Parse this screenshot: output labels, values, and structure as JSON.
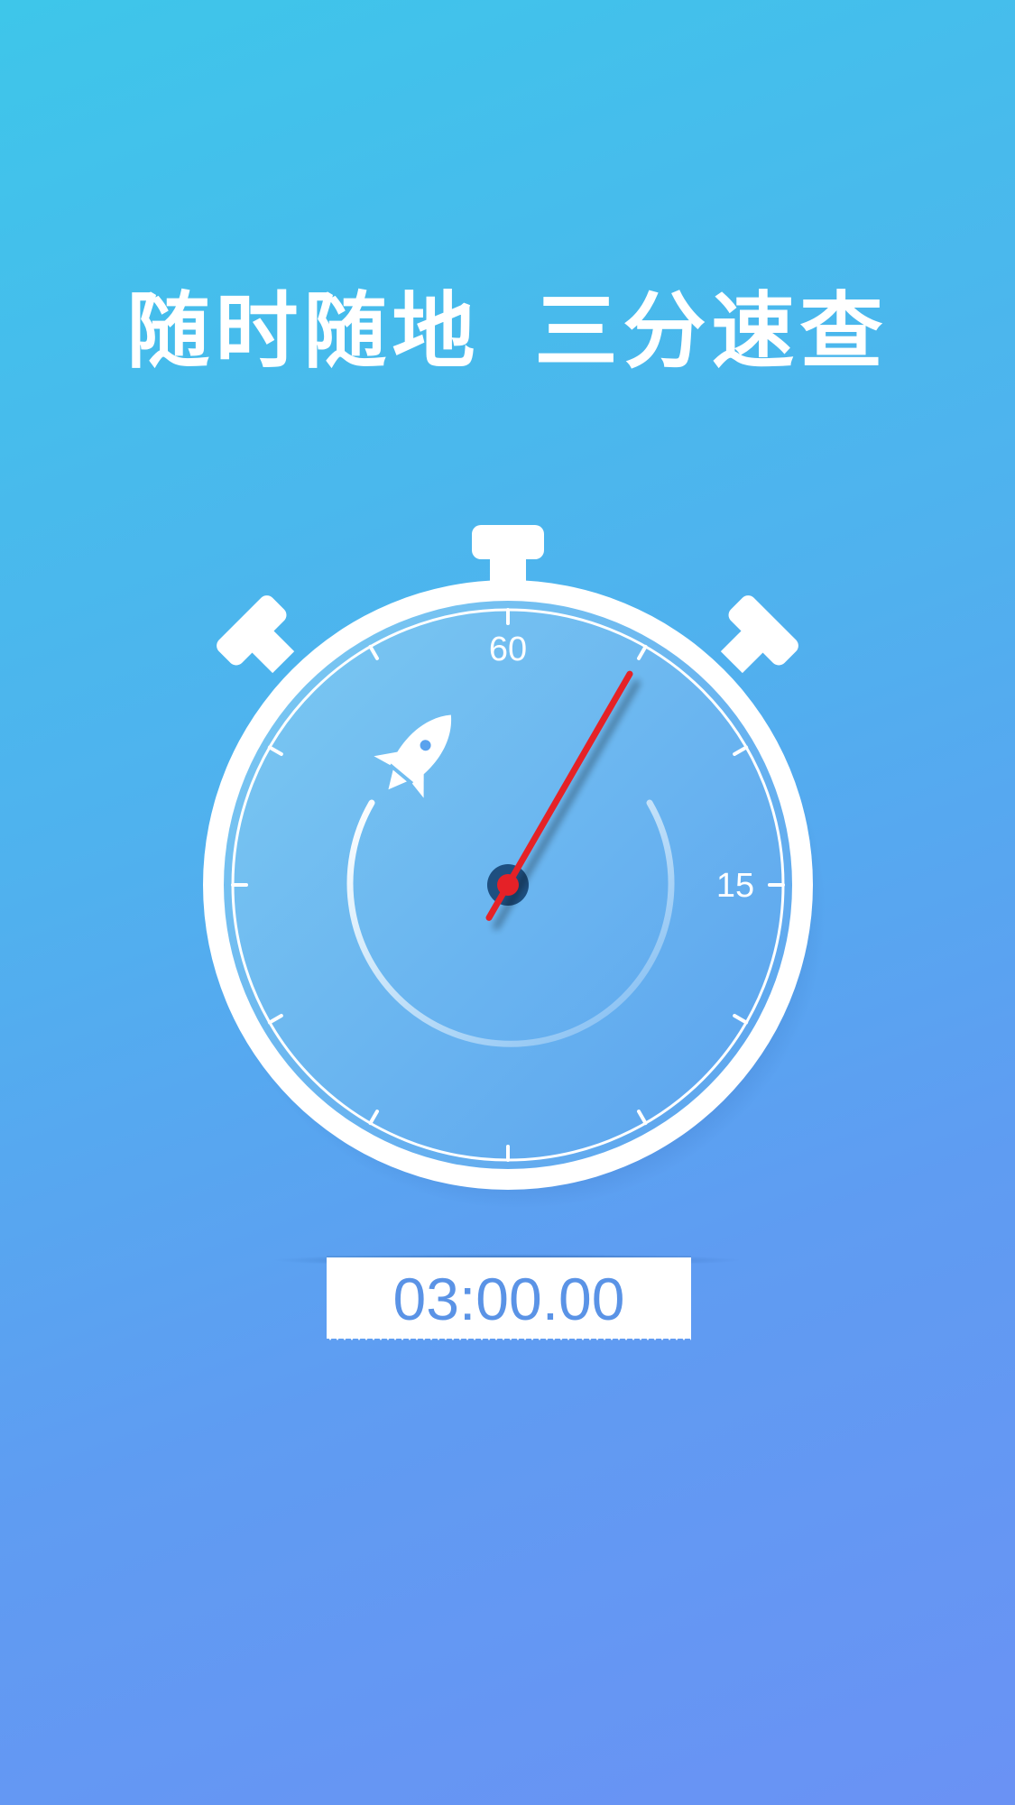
{
  "headline": {
    "part1": "随时随地",
    "part2": "三分速查"
  },
  "stopwatch": {
    "dial_label_top": "60",
    "dial_label_right": "15",
    "hand_seconds": 5,
    "icon": "rocket-icon"
  },
  "timer": {
    "value": "03:00.00"
  },
  "colors": {
    "background_start": "#3ec6ea",
    "background_end": "#6a92f4",
    "hand": "#e52127",
    "readout_text": "#5a93e6",
    "hub": "#1e4f80"
  }
}
